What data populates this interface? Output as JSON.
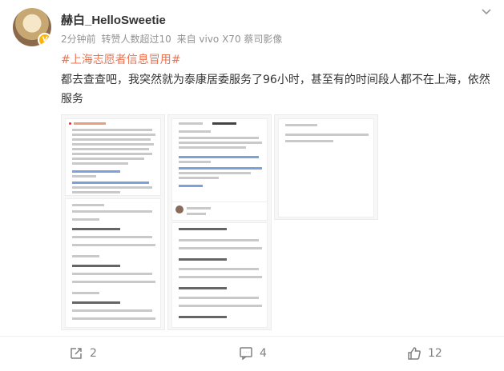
{
  "post": {
    "username": "赫白_HelloSweetie",
    "time": "2分钟前",
    "repost_note": "转赞人数超过10",
    "source": "来自 vivo X70 蔡司影像",
    "topic": "#上海志愿者信息冒用#",
    "text": "都去查查吧，我突然就为泰康居委服务了96小时，甚至有的时间段人都不在上海，依然服务"
  },
  "actions": {
    "share_count": "2",
    "comment_count": "4",
    "like_count": "12"
  },
  "icons": {
    "avatar_badge": "verified-badge-icon",
    "more": "chevron-down-icon",
    "share": "share-icon",
    "comment": "comment-icon",
    "like": "like-icon"
  },
  "colors": {
    "topic": "#eb7350",
    "meta": "#939393",
    "text": "#333333"
  }
}
